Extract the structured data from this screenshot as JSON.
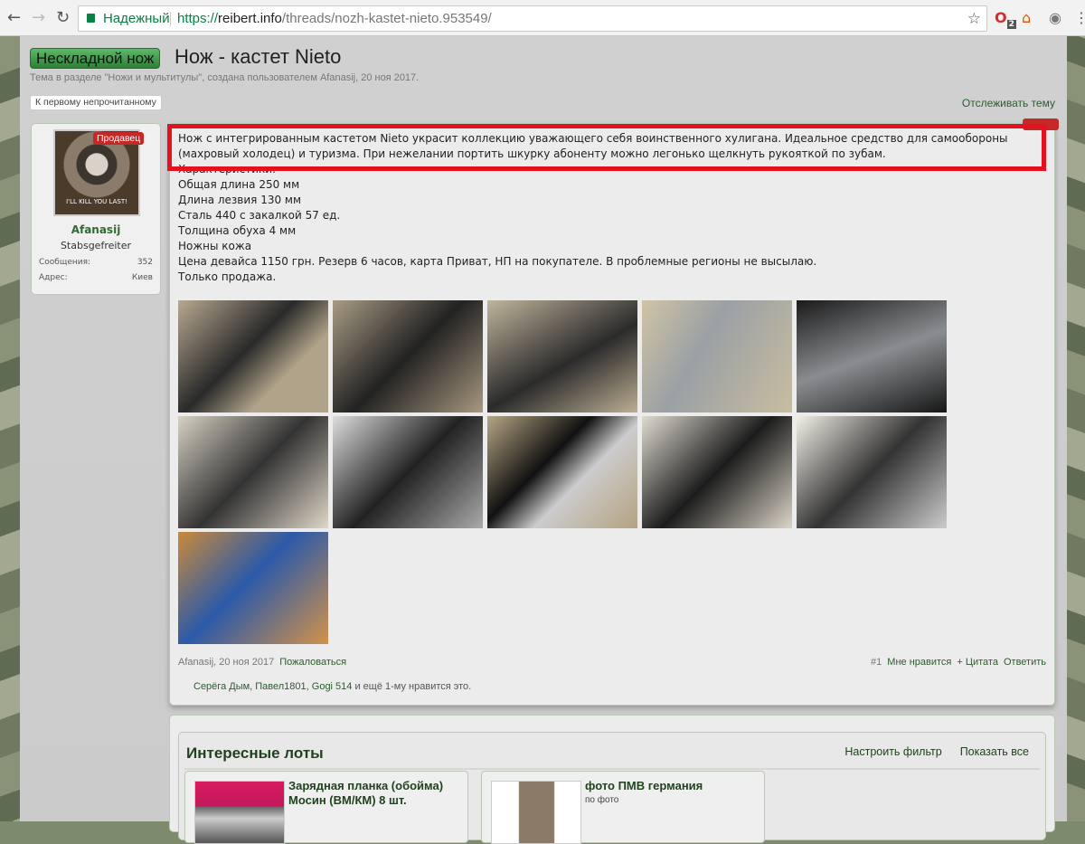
{
  "browser": {
    "secure_label": "Надежный",
    "url_scheme": "https://",
    "url_host": "reibert.info",
    "url_path": "/threads/nozh-kastet-nieto.953549/",
    "ext_badge": "2"
  },
  "thread": {
    "prefix": "Нескладной нож",
    "title": "Нож - кастет Nieto",
    "description": "Тема в разделе \"Ножи и мультитулы\", создана пользователем Afanasij, 20 ноя 2017.",
    "first_unread": "К первому непрочитанному",
    "watch": "Отслеживать тему"
  },
  "user": {
    "badge": "Продавец",
    "avatar_caption": "I'LL KILL YOU LAST!",
    "name": "Afanasij",
    "rank": "Stabsgefreiter",
    "stats": [
      {
        "label": "Сообщения:",
        "value": "352"
      },
      {
        "label": "Адрес:",
        "value": "Киев"
      }
    ]
  },
  "post": {
    "lines": [
      "Нож с интегрированным кастетом Nieto украсит коллекцию уважающего себя воинственного хулигана. Идеальное средство для самообороны (махровый холодец) и туризма. При нежелании портить шкурку абоненту можно легонько щелкнуть рукояткой по зубам.",
      "Характеристики:",
      "Общая длина 250 мм",
      "Длина лезвия 130 мм",
      "Сталь 440 с закалкой 57 ед.",
      "Толщина обуха 4 мм",
      "Ножны кожа",
      "Цена девайса 1150 грн. Резерв 6 часов, карта Приват, НП на покупателе. В проблемные регионы не высылаю.",
      "Только продажа."
    ],
    "photo_count": 11,
    "author_date": "Afanasij, 20 ноя 2017",
    "report": "Пожаловаться",
    "number": "#1",
    "like": "Мне нравится",
    "quote": "+ Цитата",
    "reply": "Ответить",
    "likes_names": "Серёга Дым, Павел1801, Gogi 514",
    "likes_suffix": " и ещё 1-му нравится это."
  },
  "lots": {
    "title": "Интересные лоты",
    "filter": "Настроить фильтр",
    "show_all": "Показать все",
    "items": [
      {
        "title": "Зарядная планка (обойма) Мосин (ВМ/КМ) 8 шт.",
        "sub": ""
      },
      {
        "title": "фото ПМВ германия",
        "sub": "по фото"
      }
    ]
  }
}
